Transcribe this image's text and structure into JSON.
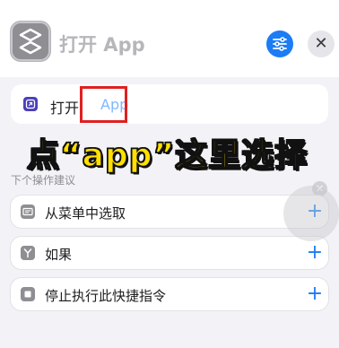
{
  "header": {
    "title": "打开 App",
    "app_icon": "shortcuts-icon",
    "settings_icon": "sliders-icon",
    "close_label": "✕"
  },
  "action": {
    "label": "打开",
    "param": "App",
    "icon": "open-app-icon",
    "clear_label": "✕"
  },
  "annotation": {
    "text": "点“app”这里选择"
  },
  "suggestions": {
    "title": "下个操作建议",
    "plus_label": "+",
    "items": [
      {
        "label": "从菜单中选取",
        "icon": "menu-icon"
      },
      {
        "label": "如果",
        "icon": "branch-icon"
      },
      {
        "label": "停止执行此快捷指令",
        "icon": "stop-icon"
      }
    ]
  },
  "colors": {
    "accent": "#1b7cf5",
    "highlight": "#e02020",
    "annotation": "#ffe000",
    "param": "#7fb8ff"
  }
}
